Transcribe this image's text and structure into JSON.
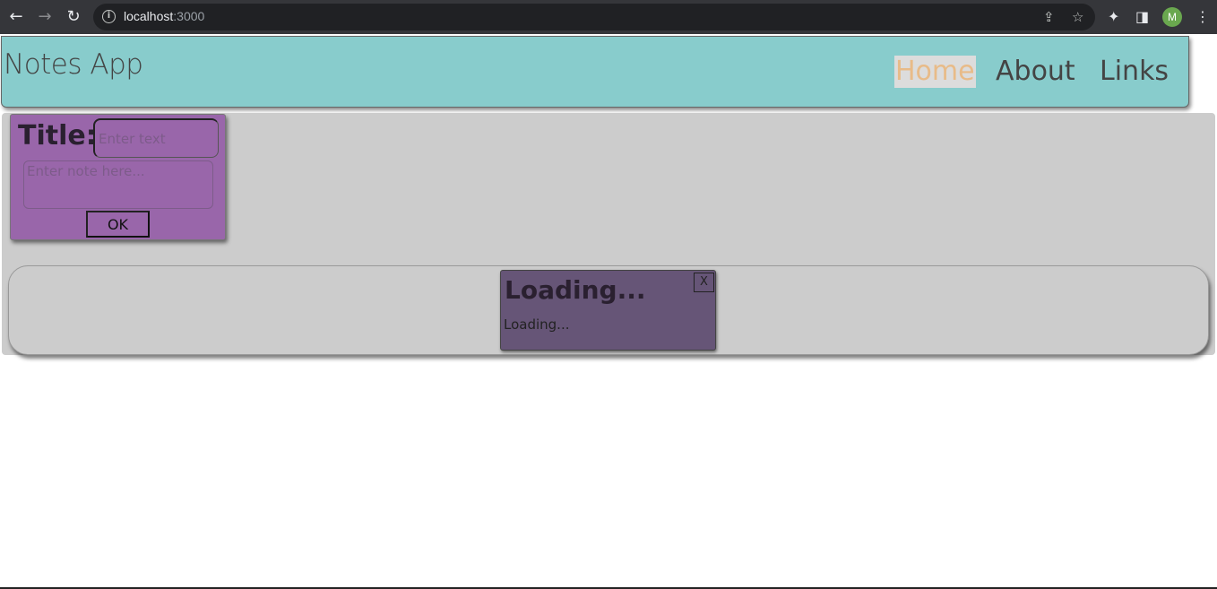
{
  "browser": {
    "url_host": "localhost",
    "url_port": ":3000",
    "back_glyph": "←",
    "forward_glyph": "→",
    "reload_glyph": "↻",
    "info_glyph": "i",
    "share_glyph": "⇪",
    "bookmark_glyph": "☆",
    "extensions_glyph": "✦",
    "sidepanel_glyph": "◨",
    "menu_glyph": "⋮",
    "profile_initial": "M"
  },
  "header": {
    "app_title": "Notes App",
    "nav": {
      "home": "Home",
      "about": "About",
      "links": "Links"
    }
  },
  "note_form": {
    "title_label": "Title:",
    "title_placeholder": "Enter text",
    "note_placeholder": "Enter note here...",
    "ok_label": "OK"
  },
  "notes": [
    {
      "title": "Loading...",
      "body": "Loading...",
      "close_label": "X"
    }
  ],
  "colors": {
    "header_bg": "#88cccc",
    "nav_active_text": "#e8bb88",
    "form_bg": "#9966aa",
    "note_card_bg": "#665577",
    "content_bg": "#cccccc"
  }
}
